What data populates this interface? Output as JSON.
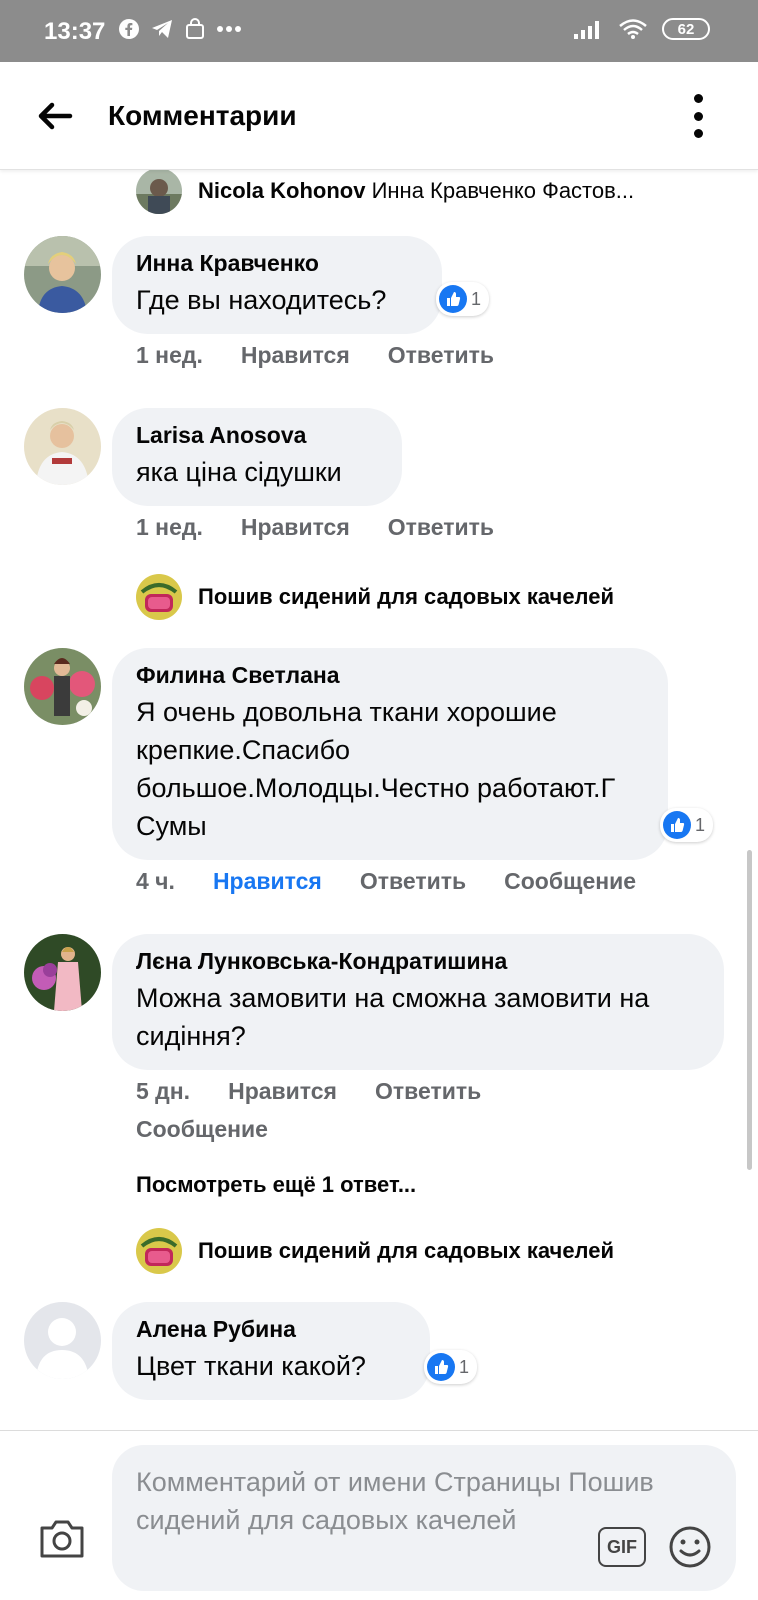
{
  "status_bar": {
    "time": "13:37",
    "battery": "62"
  },
  "app_bar": {
    "title": "Комментарии"
  },
  "top_reply": {
    "name": "Nicola Kohonov",
    "text": "Инна Кравченко Фастов..."
  },
  "comments": [
    {
      "name": "Инна Кравченко",
      "text": "Где вы находитесь?",
      "likes": "1",
      "time": "1 нед.",
      "like": "Нравится",
      "reply": "Ответить"
    },
    {
      "name": "Larisa Anosova",
      "text": "яка ціна сідушки",
      "time": "1 нед.",
      "like": "Нравится",
      "reply": "Ответить"
    },
    {
      "name": "Филина Светлана",
      "text": "Я очень довольна ткани хорошие крепкие.Спасибо большое.Молодцы.Честно работают.Г Сумы",
      "likes": "1",
      "time": "4 ч.",
      "like": "Нравится",
      "reply": "Ответить",
      "message": "Сообщение"
    },
    {
      "name": "Лєна Лунковська-Кондратишина",
      "text": "Можна замовити на сможна замовити на сидіння?",
      "time": "5 дн.",
      "like": "Нравится",
      "reply": "Ответить",
      "message": "Сообщение"
    },
    {
      "name": "Алена Рубина",
      "text": "Цвет ткани какой?",
      "likes": "1"
    }
  ],
  "page_reply": {
    "name": "Пошив сидений для садовых качелей"
  },
  "more_replies": "Посмотреть ещё 1 ответ...",
  "composer": {
    "placeholder": "Комментарий от имени Страницы Пошив сидений для садовых качелей",
    "gif": "GIF"
  },
  "colors": {
    "accent": "#1877f2",
    "bubble": "#f0f2f5",
    "statusbar": "#8c8c8c"
  }
}
